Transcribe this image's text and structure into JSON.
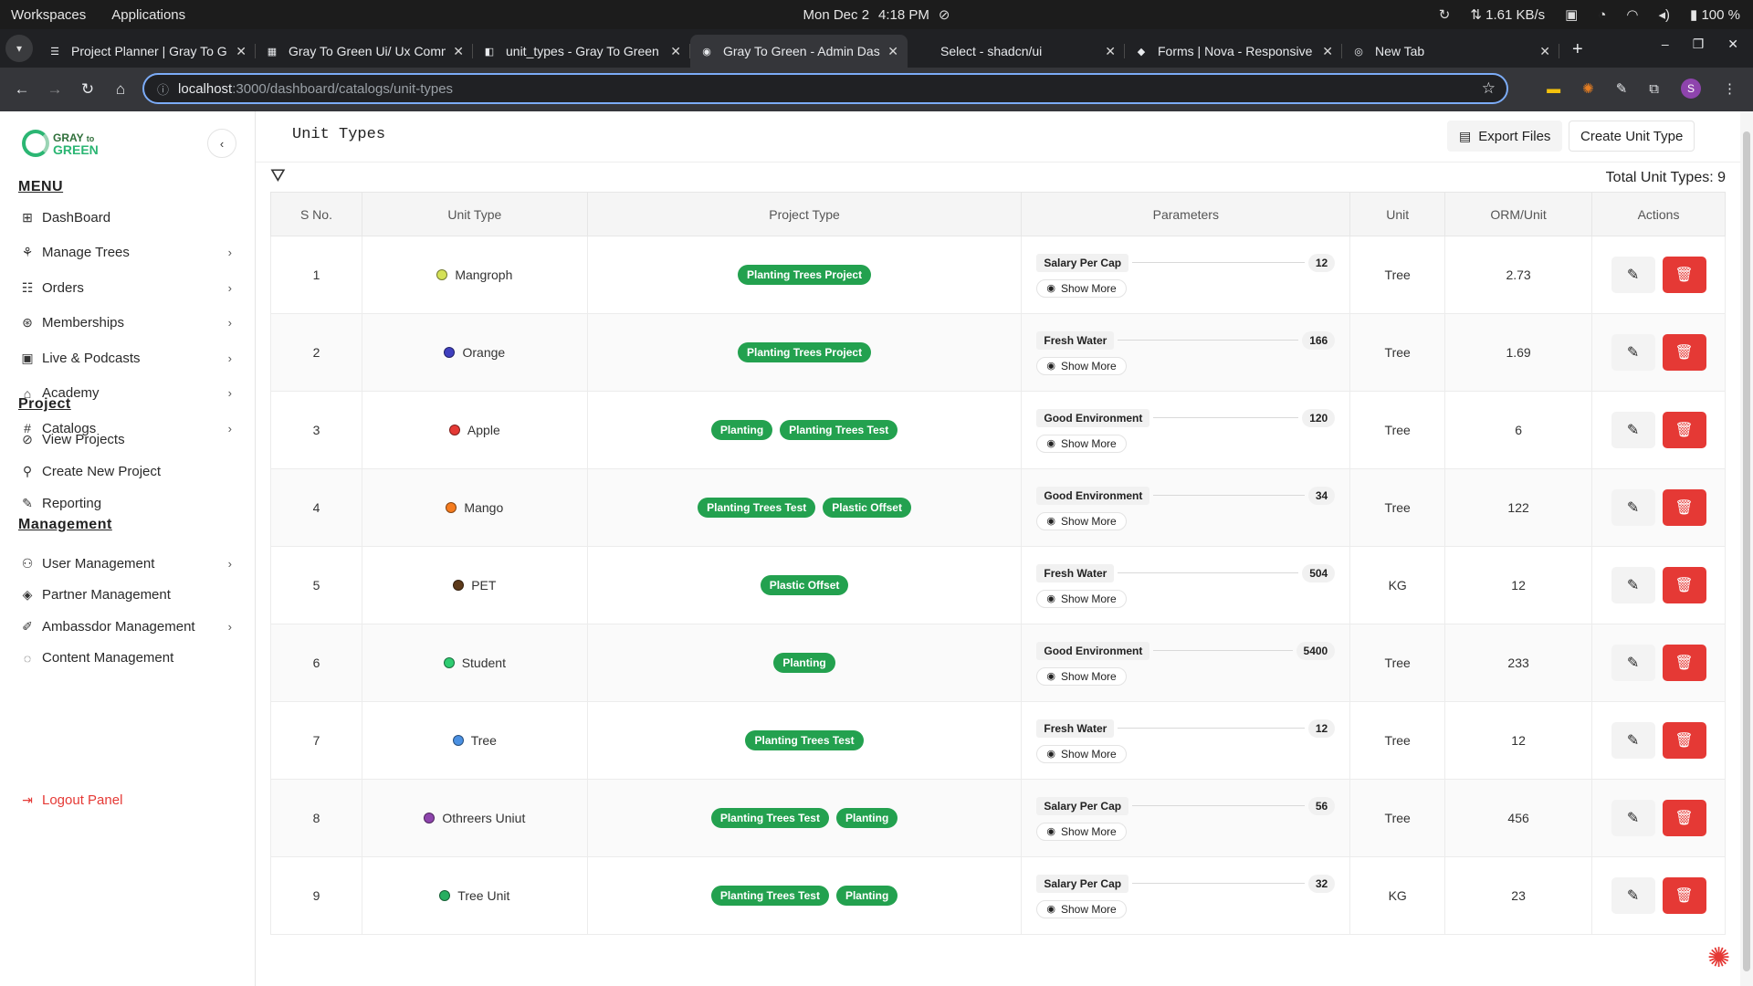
{
  "os": {
    "workspaces": "Workspaces",
    "applications": "Applications",
    "date": "Mon Dec 2",
    "time": "4:18 PM",
    "network": "1.61 KB/s",
    "battery": "100 %"
  },
  "browser": {
    "tabs": [
      {
        "title": "Project Planner | Gray To G",
        "fav": "☰",
        "active": false
      },
      {
        "title": "Gray To Green Ui/ Ux Comm",
        "fav": "▦",
        "active": false
      },
      {
        "title": "unit_types - Gray To Green",
        "fav": "◧",
        "active": false
      },
      {
        "title": "Gray To Green - Admin Das",
        "fav": "◉",
        "active": true
      },
      {
        "title": "Select - shadcn/ui",
        "fav": "",
        "active": false
      },
      {
        "title": "Forms | Nova - Responsive",
        "fav": "◆",
        "active": false
      },
      {
        "title": "New Tab",
        "fav": "◎",
        "active": false
      }
    ],
    "url_host": "localhost",
    "url_path": ":3000/dashboard/catalogs/unit-types",
    "profile_initial": "S"
  },
  "sidebar": {
    "logo_top": "GRAY",
    "logo_to": "to",
    "logo_bottom": "GREEN",
    "menu_title": "MENU",
    "menu_items": [
      {
        "label": "DashBoard",
        "icon": "⊞",
        "chevron": false
      },
      {
        "label": "Manage Trees",
        "icon": "⚘",
        "chevron": true
      },
      {
        "label": "Orders",
        "icon": "☷",
        "chevron": true
      },
      {
        "label": "Memberships",
        "icon": "⊛",
        "chevron": true
      },
      {
        "label": "Live & Podcasts",
        "icon": "▣",
        "chevron": true
      },
      {
        "label": "Academy",
        "icon": "⌂",
        "chevron": true
      },
      {
        "label": "Catalogs",
        "icon": "#",
        "chevron": true
      }
    ],
    "project_title": "Project",
    "project_items": [
      {
        "label": "View Projects",
        "icon": "⊘"
      },
      {
        "label": "Create New Project",
        "icon": "⚲"
      },
      {
        "label": "Reporting",
        "icon": "✎"
      }
    ],
    "management_title": "Management",
    "management_items": [
      {
        "label": "User Management",
        "icon": "⚇",
        "chevron": true
      },
      {
        "label": "Partner Management",
        "icon": "◈",
        "chevron": false
      },
      {
        "label": "Ambassdor Management",
        "icon": "✐",
        "chevron": true
      },
      {
        "label": "Content Management",
        "icon": "◌",
        "chevron": false
      }
    ],
    "logout": "Logout Panel"
  },
  "page": {
    "title": "Unit Types",
    "export_label": "Export Files",
    "create_label": "Create Unit Type",
    "total_label": "Total Unit Types: 9",
    "show_more_label": "Show More",
    "columns": [
      "S No.",
      "Unit Type",
      "Project Type",
      "Parameters",
      "Unit",
      "ORM/Unit",
      "Actions"
    ],
    "rows": [
      {
        "sno": "1",
        "name": "Mangroph",
        "color": "#d4e157",
        "projects": [
          "Planting Trees Project"
        ],
        "param": "Salary Per Cap",
        "pval": "12",
        "unit": "Tree",
        "orm": "2.73"
      },
      {
        "sno": "2",
        "name": "Orange",
        "color": "#3f3fbf",
        "projects": [
          "Planting Trees Project"
        ],
        "param": "Fresh Water",
        "pval": "166",
        "unit": "Tree",
        "orm": "1.69"
      },
      {
        "sno": "3",
        "name": "Apple",
        "color": "#e53935",
        "projects": [
          "Planting",
          "Planting Trees Test"
        ],
        "param": "Good Environment",
        "pval": "120",
        "unit": "Tree",
        "orm": "6"
      },
      {
        "sno": "4",
        "name": "Mango",
        "color": "#f57c1f",
        "projects": [
          "Planting Trees Test",
          "Plastic Offset"
        ],
        "param": "Good Environment",
        "pval": "34",
        "unit": "Tree",
        "orm": "122"
      },
      {
        "sno": "5",
        "name": "PET",
        "color": "#5d3a1a",
        "projects": [
          "Plastic Offset"
        ],
        "param": "Fresh Water",
        "pval": "504",
        "unit": "KG",
        "orm": "12"
      },
      {
        "sno": "6",
        "name": "Student",
        "color": "#2ecc71",
        "projects": [
          "Planting"
        ],
        "param": "Good Environment",
        "pval": "5400",
        "unit": "Tree",
        "orm": "233"
      },
      {
        "sno": "7",
        "name": "Tree",
        "color": "#4a90e2",
        "projects": [
          "Planting Trees Test"
        ],
        "param": "Fresh Water",
        "pval": "12",
        "unit": "Tree",
        "orm": "12"
      },
      {
        "sno": "8",
        "name": "Othreers Uniut",
        "color": "#8e44ad",
        "projects": [
          "Planting Trees Test",
          "Planting"
        ],
        "param": "Salary Per Cap",
        "pval": "56",
        "unit": "Tree",
        "orm": "456"
      },
      {
        "sno": "9",
        "name": "Tree Unit",
        "color": "#27ae60",
        "projects": [
          "Planting Trees Test",
          "Planting"
        ],
        "param": "Salary Per Cap",
        "pval": "32",
        "unit": "KG",
        "orm": "23"
      }
    ]
  },
  "colors": {
    "pill_green": "#23a14f",
    "delete_red": "#e53935",
    "logout_red": "#e53935"
  }
}
